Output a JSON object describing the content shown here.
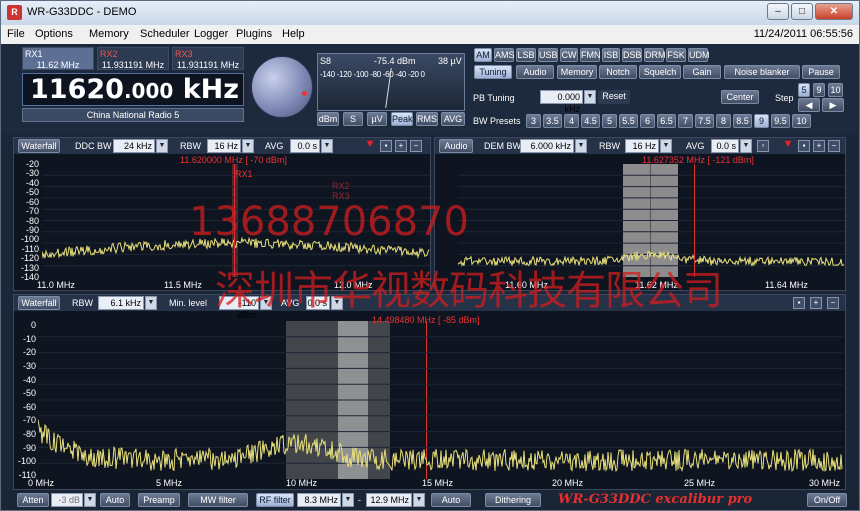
{
  "window": {
    "title": "WR-G33DDC - DEMO",
    "icon": "radio-app-icon",
    "minimize": "–",
    "maximize": "□",
    "close": "✕"
  },
  "menu": {
    "items": [
      "File",
      "Options",
      "Memory",
      "Scheduler",
      "Logger",
      "Plugins",
      "Help"
    ],
    "datetime": "11/24/2011 06:55:56"
  },
  "receivers": [
    {
      "name": "RX1",
      "freq": "11.62 MHz"
    },
    {
      "name": "RX2",
      "freq": "11.931191 MHz"
    },
    {
      "name": "RX3",
      "freq": "11.931191 MHz"
    }
  ],
  "frequency": {
    "value": "11620",
    "decimals": ".000",
    "unit": "kHz",
    "station": "China National Radio 5"
  },
  "smeter": {
    "s_label": "S8",
    "dbm": "-75.4 dBm",
    "uv": "38 µV",
    "scale": "-140 -120 -100 -80 -60 -40 -20 0",
    "buttons": [
      "dBm",
      "S",
      "µV",
      "Peak",
      "RMS",
      "AVG"
    ],
    "active": "Peak"
  },
  "modes": {
    "items": [
      "AM",
      "AMS",
      "LSB",
      "USB",
      "CW",
      "FMN",
      "ISB",
      "DSB",
      "DRM",
      "FSK",
      "UDM"
    ],
    "active": "AM"
  },
  "tabs": {
    "items": [
      "Tuning",
      "Audio",
      "Memory",
      "Notch",
      "Squelch",
      "Gain",
      "Noise blanker",
      "Pause"
    ],
    "active": "Tuning"
  },
  "tuning": {
    "pb_label": "PB Tuning",
    "pb_value": "0.000 kHz",
    "reset": "Reset",
    "center": "Center",
    "step_label": "Step",
    "step_buttons": [
      "5",
      "9",
      "10"
    ],
    "bw_label": "BW Presets",
    "bw_presets": [
      "3",
      "3.5",
      "4",
      "4.5",
      "5",
      "5.5",
      "6",
      "6.5",
      "7",
      "7.5",
      "8",
      "8.5",
      "9",
      "9.5",
      "10"
    ],
    "bw_active": "9"
  },
  "ddc_panel": {
    "waterfall": "Waterfall",
    "ddc_bw_label": "DDC BW",
    "ddc_bw": "24 kHz",
    "rbw_label": "RBW",
    "rbw": "16 Hz",
    "avg_label": "AVG",
    "avg": "0.0 s",
    "cursor": "11.620000 MHz [ -70 dBm]",
    "marks": [
      "RX1",
      "RX2",
      "RX3"
    ],
    "y_ticks": [
      "-20",
      "-30",
      "-40",
      "-50",
      "-60",
      "-70",
      "-80",
      "-90",
      "-100",
      "-110",
      "-120",
      "-130",
      "-140"
    ],
    "x_ticks": [
      "11.0 MHz",
      "11.5 MHz",
      "12.0 MHz"
    ]
  },
  "dem_panel": {
    "audio": "Audio",
    "dem_bw_label": "DEM BW",
    "dem_bw": "6.000 kHz",
    "rbw_label": "RBW",
    "rbw": "16 Hz",
    "avg_label": "AVG",
    "avg": "0.0 s",
    "cursor": "11.627352 MHz [ -121 dBm]",
    "x_ticks": [
      "11.60 MHz",
      "11.62 MHz",
      "11.64 MHz"
    ]
  },
  "wide_panel": {
    "waterfall": "Waterfall",
    "rbw_label": "RBW",
    "rbw": "6.1 kHz",
    "min_label": "Min. level",
    "min": "-110 dBm",
    "avg_label": "AVG",
    "avg": "0.0 s",
    "cursor": "14.498480 MHz [ -85 dBm]",
    "y_ticks": [
      "0",
      "-10",
      "-20",
      "-30",
      "-40",
      "-50",
      "-60",
      "-70",
      "-80",
      "-90",
      "-100",
      "-110"
    ],
    "x_ticks": [
      "0 MHz",
      "5 MHz",
      "10 MHz",
      "15 MHz",
      "20 MHz",
      "25 MHz",
      "30 MHz"
    ]
  },
  "bottom": {
    "atten": "Atten",
    "atten_val": "-3 dB",
    "auto1": "Auto",
    "preamp": "Preamp",
    "mw": "MW filter",
    "rf": "RF filter",
    "rf_from": "8.3 MHz",
    "rf_to": "12.9 MHz",
    "auto2": "Auto",
    "dither": "Dithering",
    "brand": "WR-G33DDC excalibur pro",
    "onoff": "On/Off"
  },
  "watermark": {
    "phone": "13688706870",
    "company": "深圳市华视数码科技有限公司"
  },
  "colors": {
    "trace": "#e8e07a",
    "marker": "#e03030",
    "filter": "#8c8c8c",
    "bg": "#0a0f18"
  }
}
